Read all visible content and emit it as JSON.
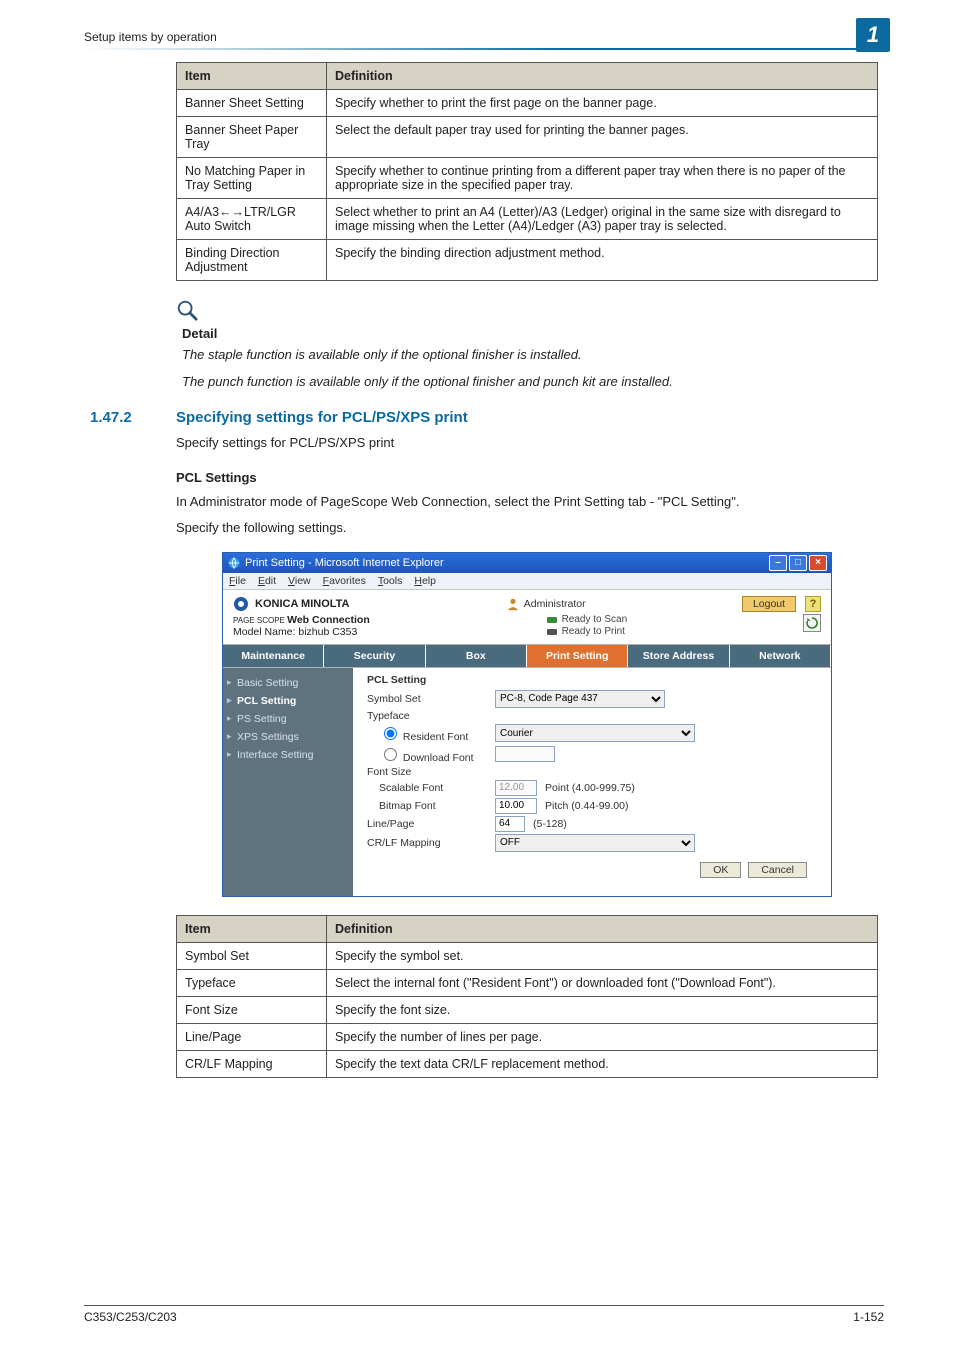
{
  "breadcrumb": "Setup items by operation",
  "chapter_badge": "1",
  "table_top": {
    "headers": [
      "Item",
      "Definition"
    ],
    "rows": [
      [
        "Banner Sheet Setting",
        "Specify whether to print the first page on the banner page."
      ],
      [
        "Banner Sheet Paper Tray",
        "Select the default paper tray used for printing the banner pages."
      ],
      [
        "No Matching Paper in Tray Setting",
        "Specify whether to continue printing from a different paper tray when there is no paper of the appropriate size in the specified paper tray."
      ],
      [
        "A4/A3←→LTR/LGR Auto Switch",
        "Select whether to print an A4 (Letter)/A3 (Ledger) original in the same size with disregard to image missing when the Letter (A4)/Ledger (A3) paper tray is selected."
      ],
      [
        "Binding Direction Adjustment",
        "Specify the binding direction adjustment method."
      ]
    ]
  },
  "detail": {
    "label": "Detail",
    "line1": "The staple function is available only if the optional finisher is installed.",
    "line2": "The punch function is available only if the optional finisher and punch kit are installed."
  },
  "section": {
    "num": "1.47.2",
    "title": "Specifying settings for PCL/PS/XPS print",
    "intro": "Specify settings for PCL/PS/XPS print",
    "sub_head": "PCL Settings",
    "para1": "In Administrator mode of PageScope Web Connection, select the Print Setting tab - \"PCL Setting\".",
    "para2": "Specify the following settings."
  },
  "ie": {
    "title": "Print Setting - Microsoft Internet Explorer",
    "menus": [
      "File",
      "Edit",
      "View",
      "Favorites",
      "Tools",
      "Help"
    ],
    "brand": "KONICA MINOLTA",
    "admin": "Administrator",
    "logout": "Logout",
    "help": "?",
    "web_conn_prefix": "PAGE SCOPE ",
    "web_conn": "Web Connection",
    "model": "Model Name: bizhub C353",
    "ready_scan": "Ready to Scan",
    "ready_print": "Ready to Print",
    "tabs": {
      "maint": "Maintenance",
      "sec": "Security",
      "box": "Box",
      "print": "Print Setting",
      "store": "Store Address",
      "net": "Network"
    },
    "nav": {
      "basic": "Basic Setting",
      "pcl": "PCL Setting",
      "ps": "PS Setting",
      "xps": "XPS Settings",
      "iface": "Interface Setting"
    },
    "form": {
      "title": "PCL Setting",
      "symbol_set": "Symbol Set",
      "symbol_set_val": "PC-8, Code Page 437",
      "typeface": "Typeface",
      "resident": "Resident Font",
      "resident_val": "Courier",
      "download": "Download Font",
      "font_size": "Font Size",
      "scalable": "Scalable Font",
      "scalable_val": "12.00",
      "scalable_range": "Point (4.00-999.75)",
      "bitmap": "Bitmap Font",
      "bitmap_val": "10.00",
      "bitmap_range": "Pitch (0.44-99.00)",
      "line_page": "Line/Page",
      "line_page_val": "64",
      "line_page_range": "(5-128)",
      "crlf": "CR/LF Mapping",
      "crlf_val": "OFF",
      "ok": "OK",
      "cancel": "Cancel"
    }
  },
  "table_bottom": {
    "headers": [
      "Item",
      "Definition"
    ],
    "rows": [
      [
        "Symbol Set",
        "Specify the symbol set."
      ],
      [
        "Typeface",
        "Select the internal font (\"Resident Font\") or downloaded font (\"Download Font\")."
      ],
      [
        "Font Size",
        "Specify the font size."
      ],
      [
        "Line/Page",
        "Specify the number of lines per page."
      ],
      [
        "CR/LF Mapping",
        "Specify the text data CR/LF replacement method."
      ]
    ]
  },
  "footer": {
    "left": "C353/C253/C203",
    "right": "1-152"
  }
}
